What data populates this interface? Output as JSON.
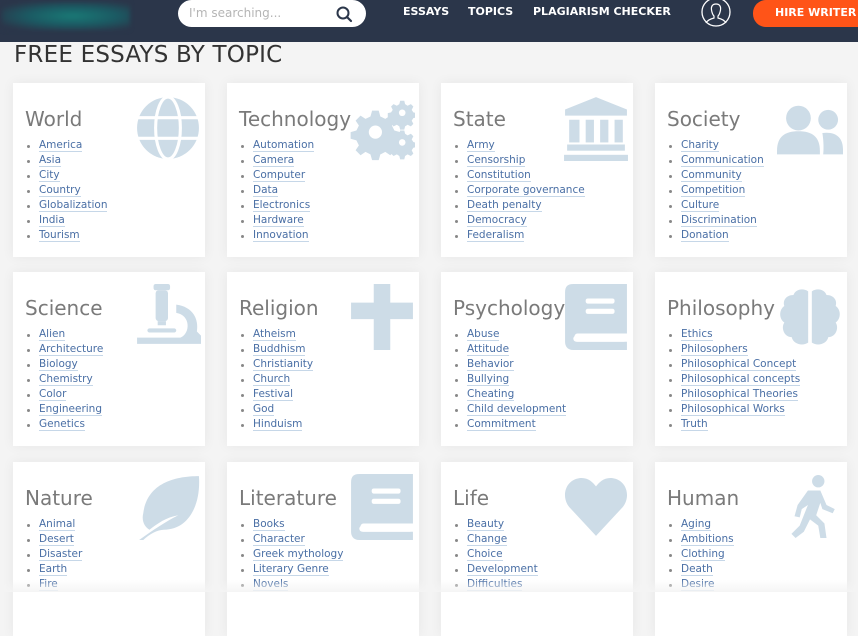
{
  "header": {
    "search_placeholder": "I'm searching...",
    "nav": [
      "ESSAYS",
      "TOPICS",
      "PLAGIARISM CHECKER"
    ],
    "hire_button": "HIRE WRITER",
    "colors": {
      "bar": "#2b364a",
      "accent": "#ff5418"
    }
  },
  "page_title": "FREE ESSAYS BY TOPIC",
  "icon_color": "#cddce7",
  "topics": [
    {
      "title": "World",
      "icon": "globe-icon",
      "items": [
        "America",
        "Asia",
        "City",
        "Country",
        "Globalization",
        "India",
        "Tourism"
      ]
    },
    {
      "title": "Technology",
      "icon": "gears-icon",
      "items": [
        "Automation",
        "Camera",
        "Computer",
        "Data",
        "Electronics",
        "Hardware",
        "Innovation"
      ]
    },
    {
      "title": "State",
      "icon": "landmark-icon",
      "items": [
        "Army",
        "Censorship",
        "Constitution",
        "Corporate governance",
        "Death penalty",
        "Democracy",
        "Federalism"
      ]
    },
    {
      "title": "Society",
      "icon": "users-icon",
      "items": [
        "Charity",
        "Communication",
        "Community",
        "Competition",
        "Culture",
        "Discrimination",
        "Donation"
      ]
    },
    {
      "title": "Science",
      "icon": "microscope-icon",
      "items": [
        "Alien",
        "Architecture",
        "Biology",
        "Chemistry",
        "Color",
        "Engineering",
        "Genetics"
      ]
    },
    {
      "title": "Religion",
      "icon": "cross-icon",
      "items": [
        "Atheism",
        "Buddhism",
        "Christianity",
        "Church",
        "Festival",
        "God",
        "Hinduism"
      ]
    },
    {
      "title": "Psychology",
      "icon": "book-icon",
      "items": [
        "Abuse",
        "Attitude",
        "Behavior",
        "Bullying",
        "Cheating",
        "Child development",
        "Commitment"
      ]
    },
    {
      "title": "Philosophy",
      "icon": "brain-icon",
      "items": [
        "Ethics",
        "Philosophers",
        "Philosophical Concept",
        "Philosophical concepts",
        "Philosophical Theories",
        "Philosophical Works",
        "Truth"
      ]
    },
    {
      "title": "Nature",
      "icon": "leaf-icon",
      "items": [
        "Animal",
        "Desert",
        "Disaster",
        "Earth",
        "Fire"
      ]
    },
    {
      "title": "Literature",
      "icon": "book-icon",
      "items": [
        "Books",
        "Character",
        "Greek mythology",
        "Literary Genre",
        "Novels"
      ]
    },
    {
      "title": "Life",
      "icon": "heart-icon",
      "items": [
        "Beauty",
        "Change",
        "Choice",
        "Development",
        "Difficulties"
      ]
    },
    {
      "title": "Human",
      "icon": "walking-person-icon",
      "items": [
        "Aging",
        "Ambitions",
        "Clothing",
        "Death",
        "Desire"
      ]
    }
  ]
}
